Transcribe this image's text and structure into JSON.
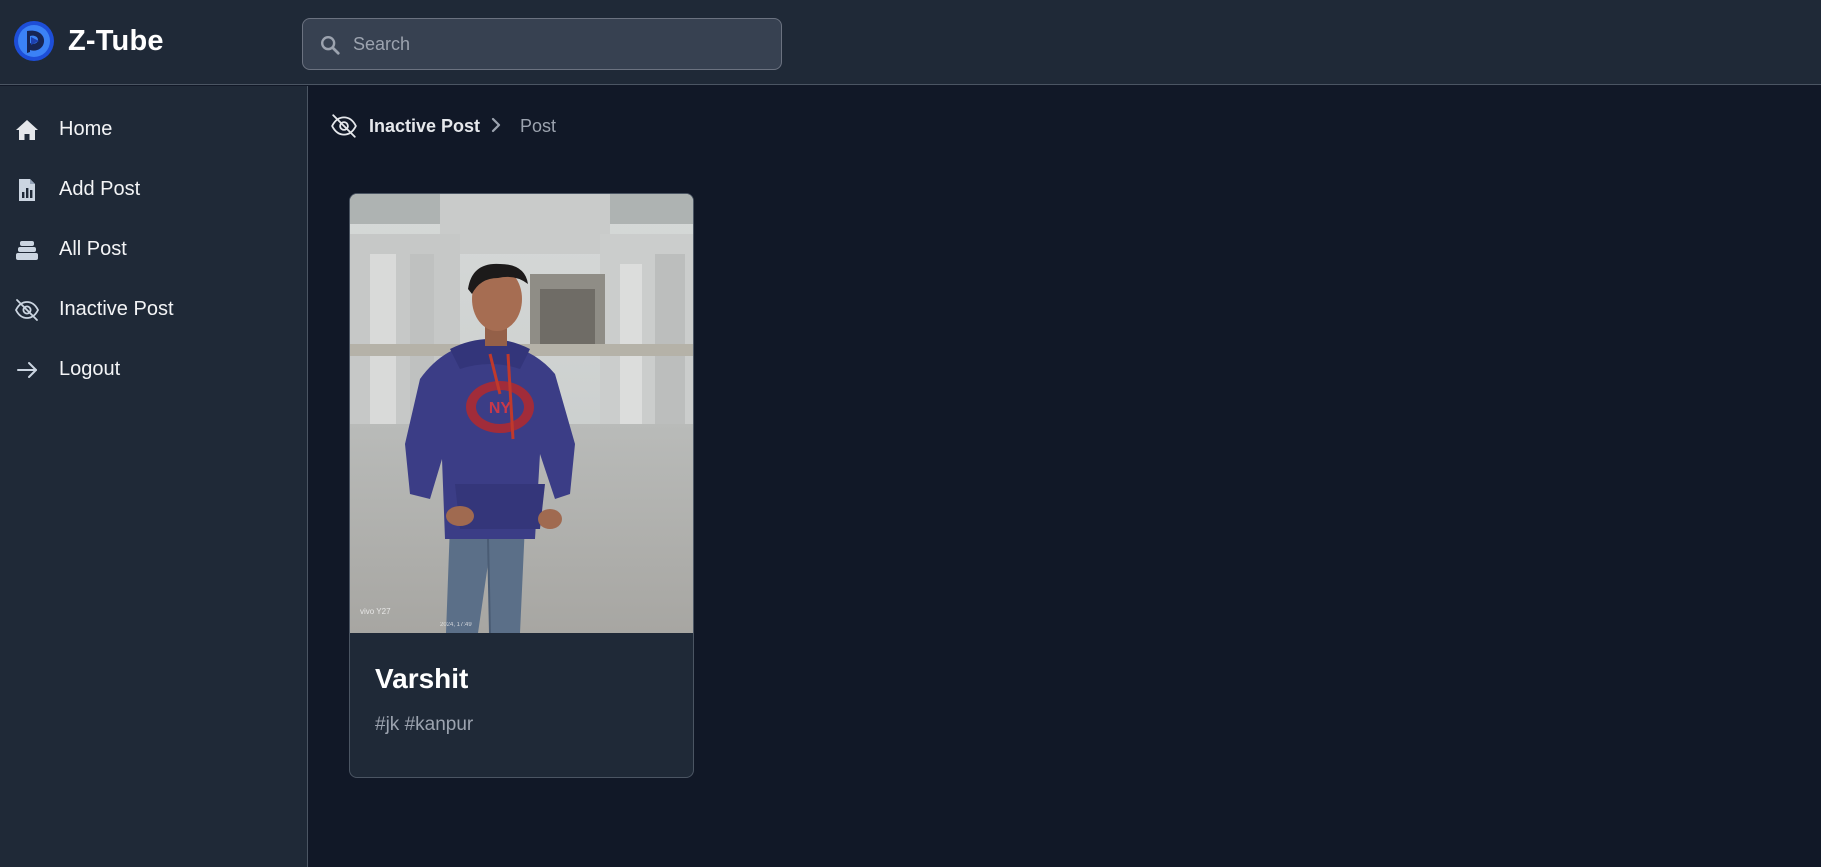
{
  "header": {
    "brand_name": "Z-Tube",
    "search": {
      "placeholder": "Search",
      "value": ""
    }
  },
  "sidebar": {
    "items": [
      {
        "label": "Home",
        "icon": "home-icon"
      },
      {
        "label": "Add Post",
        "icon": "add-post-icon"
      },
      {
        "label": "All Post",
        "icon": "stack-icon"
      },
      {
        "label": "Inactive Post",
        "icon": "eye-off-icon"
      },
      {
        "label": "Logout",
        "icon": "arrow-right-icon"
      }
    ]
  },
  "breadcrumb": {
    "items": [
      "Inactive Post",
      "Post"
    ],
    "icon": "eye-off-icon",
    "separator_icon": "chevron-right-icon"
  },
  "posts": [
    {
      "title": "Varshit",
      "tags": "#jk #kanpur",
      "image": "photo of a young man in a navy hoodie standing in front of a stone building"
    }
  ],
  "colors": {
    "page_bg": "#111827",
    "panel_bg": "#1f2937",
    "border": "#4b5563",
    "accent": "#2563eb",
    "text": "#e5e7eb",
    "muted": "#9ca3af"
  }
}
